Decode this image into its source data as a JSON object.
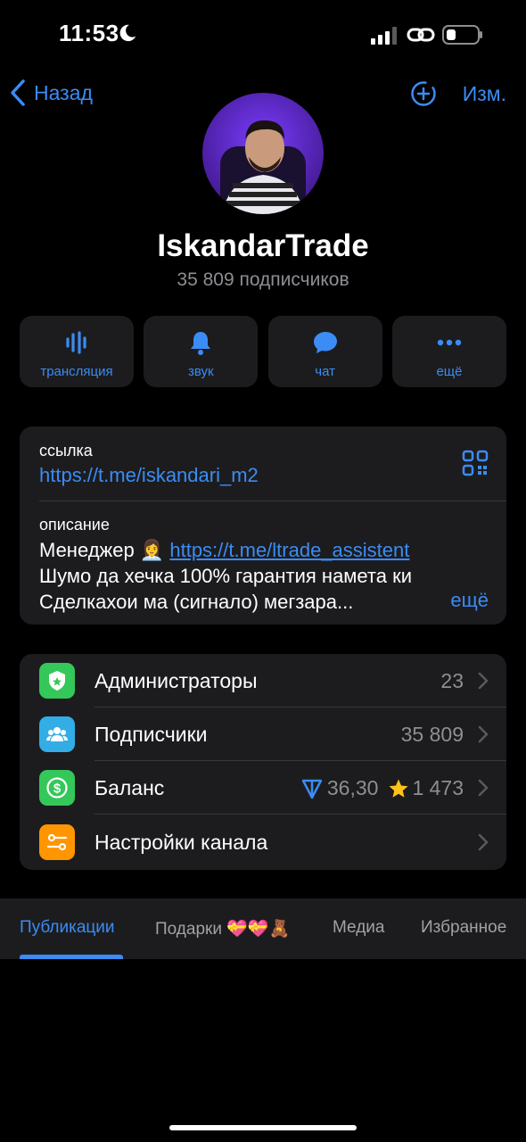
{
  "status": {
    "time": "11:53"
  },
  "nav": {
    "back_label": "Назад",
    "edit_label": "Изм."
  },
  "profile": {
    "name": "IskandarTrade",
    "subscribers": "35 809 подписчиков"
  },
  "actions": [
    {
      "label": "трансляция",
      "icon": "broadcast-icon"
    },
    {
      "label": "звук",
      "icon": "bell-icon"
    },
    {
      "label": "чат",
      "icon": "chat-bubble-icon"
    },
    {
      "label": "ещё",
      "icon": "more-dots-icon"
    }
  ],
  "info": {
    "link_label": "ссылка",
    "link_value": "https://t.me/iskandari_m2",
    "desc_label": "описание",
    "desc_prefix": "Менеджер 👩‍💼 ",
    "desc_link": "https://t.me/ltrade_assistent",
    "desc_line2": "Шумо да хечка 100% гарантия намета ки",
    "desc_line3": "Сделкахои ма (сигнало) мегзара...",
    "more_label": "ещё"
  },
  "list": [
    {
      "title": "Администраторы",
      "value": "23",
      "icon": "admin-shield-icon",
      "color": "#34c759"
    },
    {
      "title": "Подписчики",
      "value": "35 809",
      "icon": "people-icon",
      "color": "#32ade6"
    },
    {
      "title": "Баланс",
      "value_ton": "36,30",
      "value_stars": "1 473",
      "icon": "dollar-icon",
      "color": "#34c759"
    },
    {
      "title": "Настройки канала",
      "value": "",
      "icon": "settings-sliders-icon",
      "color": "#ff9500"
    }
  ],
  "tabs": [
    {
      "label": "Публикации",
      "active": true
    },
    {
      "label": "Подарки 💝💝🧸",
      "active": false
    },
    {
      "label": "Медиа",
      "active": false
    },
    {
      "label": "Избранное",
      "active": false
    }
  ],
  "colors": {
    "accent": "#3b8cf5",
    "card": "#1c1c1e",
    "background": "#000000"
  }
}
